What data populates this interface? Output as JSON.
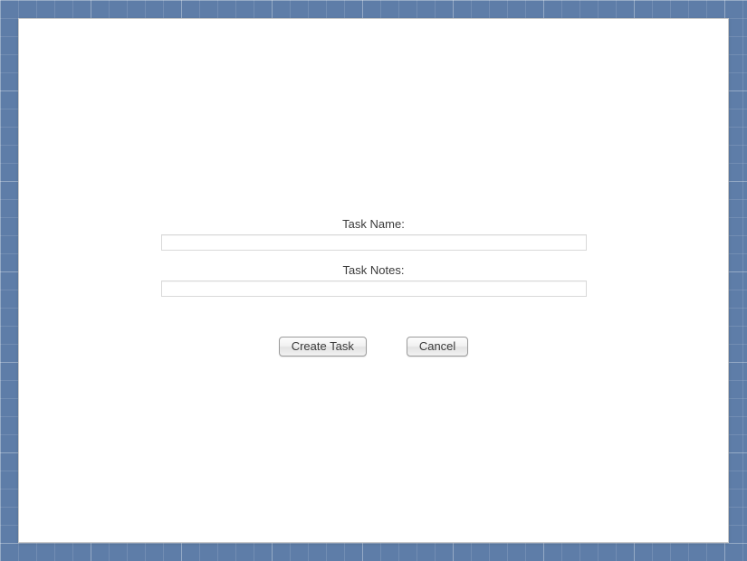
{
  "form": {
    "task_name_label": "Task Name:",
    "task_name_value": "",
    "task_notes_label": "Task Notes:",
    "task_notes_value": "",
    "create_label": "Create Task",
    "cancel_label": "Cancel"
  }
}
